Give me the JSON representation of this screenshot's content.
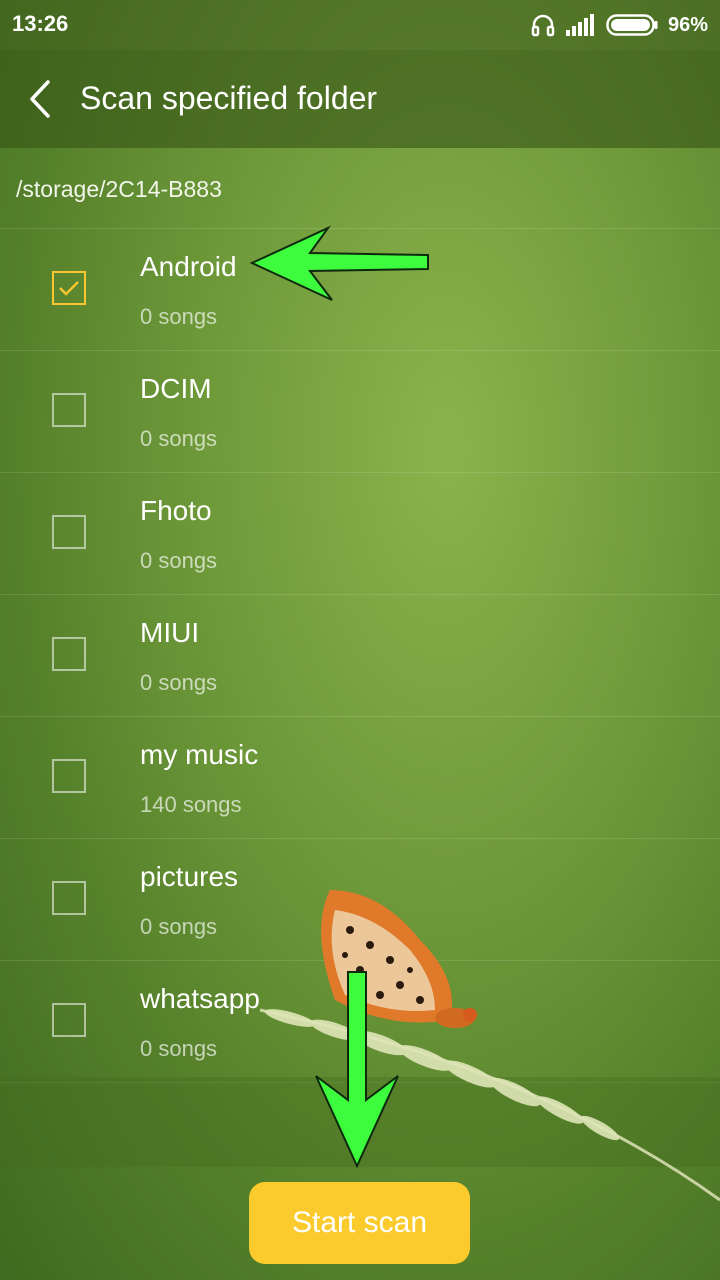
{
  "status_bar": {
    "time": "13:26",
    "battery_percent": "96%",
    "icons": [
      "headset-icon",
      "signal-icon",
      "battery-icon"
    ]
  },
  "app_bar": {
    "title": "Scan specified folder",
    "back_icon": "back-arrow-icon"
  },
  "path": "/storage/2C14-B883",
  "folders": [
    {
      "name": "Android",
      "count": "0 songs",
      "checked": true
    },
    {
      "name": "DCIM",
      "count": "0 songs",
      "checked": false
    },
    {
      "name": "Fhoto",
      "count": "0 songs",
      "checked": false
    },
    {
      "name": "MIUI",
      "count": "0 songs",
      "checked": false
    },
    {
      "name": "my music",
      "count": "140 songs",
      "checked": false
    },
    {
      "name": "pictures",
      "count": "0 songs",
      "checked": false
    },
    {
      "name": "whatsapp",
      "count": "0 songs",
      "checked": false
    }
  ],
  "start_button": {
    "label": "Start scan"
  },
  "colors": {
    "accent": "#fbca2d",
    "checkbox_checked": "#f8c62e",
    "annotation_arrow": "#3dfc3d"
  }
}
